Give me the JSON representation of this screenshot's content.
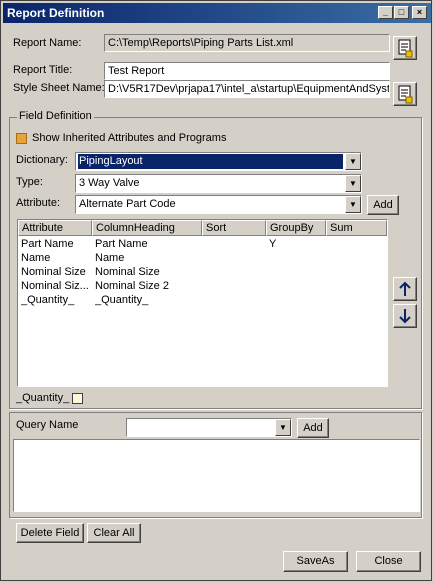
{
  "window": {
    "title": "Report Definition",
    "minimize_glyph": "_",
    "maximize_glyph": "□",
    "close_glyph": "×"
  },
  "report": {
    "name_label": "Report Name:",
    "name_value": "C:\\Temp\\Reports\\Piping Parts List.xml",
    "title_label": "Report Title:",
    "title_value": "Test Report",
    "stylesheet_label": "Style Sheet Name:",
    "stylesheet_value": "D:\\V5R17Dev\\prjapa17\\intel_a\\startup\\EquipmentAndSyst"
  },
  "field_definition": {
    "group_label": "Field Definition",
    "show_inherited_label": "Show Inherited Attributes and Programs",
    "show_inherited_checked": true,
    "dictionary_label": "Dictionary:",
    "dictionary_value": "PipingLayout",
    "type_label": "Type:",
    "type_value": "3 Way Valve",
    "attribute_label": "Attribute:",
    "attribute_value": "Alternate Part Code",
    "add_label": "Add"
  },
  "table": {
    "headers": [
      "Attribute",
      "ColumnHeading",
      "Sort",
      "GroupBy",
      "Sum"
    ],
    "rows": [
      [
        "Part Name",
        "Part Name",
        "",
        "Y",
        ""
      ],
      [
        "Name",
        "Name",
        "",
        "",
        ""
      ],
      [
        "Nominal Size",
        "Nominal Size",
        "",
        "",
        ""
      ],
      [
        "Nominal Siz...",
        "Nominal Size 2",
        "",
        "",
        ""
      ],
      [
        "_Quantity_",
        "_Quantity_",
        "",
        "",
        ""
      ]
    ]
  },
  "move_up_icon": "arrow-up-icon",
  "move_down_icon": "arrow-down-icon",
  "selected_field": {
    "label": "_Quantity_"
  },
  "query": {
    "label": "Query Name",
    "value": "",
    "add_label": "Add"
  },
  "buttons": {
    "delete_field": "Delete Field",
    "clear_all": "Clear All",
    "save_as": "SaveAs",
    "close": "Close"
  },
  "colors": {
    "titlebar": "#0a246a",
    "selection": "#0a246a",
    "window_bg": "#d4d0c8",
    "checkbox_fill": "#e8a23a"
  }
}
